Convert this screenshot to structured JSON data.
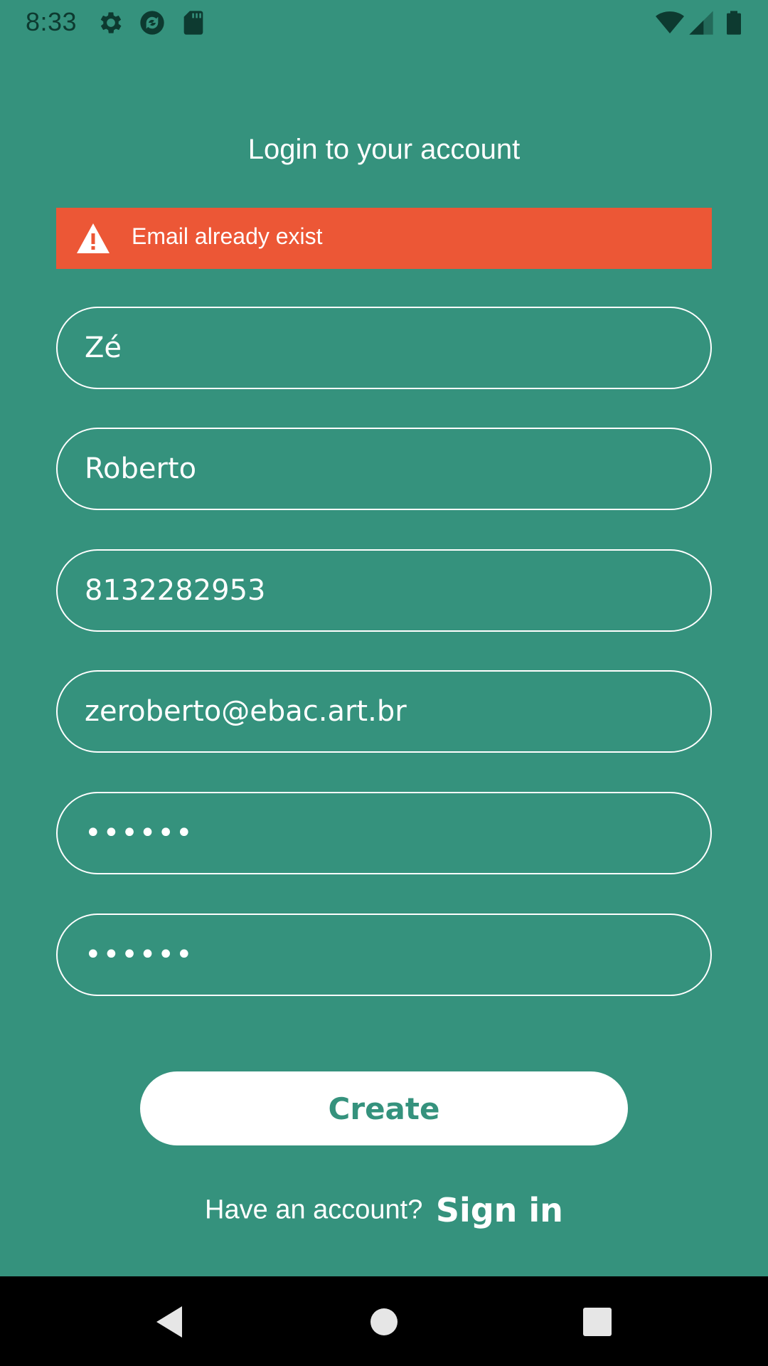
{
  "status_bar": {
    "time": "8:33",
    "left_icons": [
      "gear-icon",
      "sync-icon",
      "sd-card-icon"
    ],
    "right_icons": [
      "wifi-icon",
      "signal-icon",
      "battery-icon"
    ]
  },
  "screen": {
    "title": "Login to your account"
  },
  "alert": {
    "icon": "warning-icon",
    "message": "Email already exist",
    "color": "#ec5736"
  },
  "form": {
    "first_name": "Zé",
    "last_name": "Roberto",
    "phone": "8132282953",
    "email": "zeroberto@ebac.art.br",
    "password": "••••••",
    "confirm_password": "••••••"
  },
  "actions": {
    "create_label": "Create"
  },
  "footer": {
    "prompt": "Have an account?",
    "link_label": "Sign in"
  },
  "navigation": {
    "buttons": [
      "back-icon",
      "home-icon",
      "recents-icon"
    ]
  },
  "colors": {
    "background": "#35927d",
    "accent": "#ffffff",
    "error": "#ec5736"
  }
}
